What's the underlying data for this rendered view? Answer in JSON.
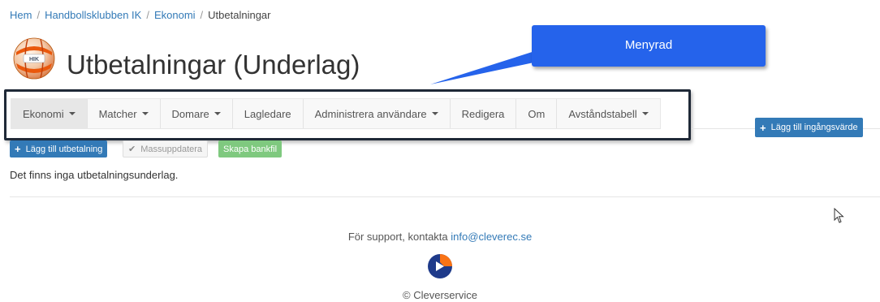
{
  "breadcrumb": {
    "items": [
      "Hem",
      "Handbollsklubben IK",
      "Ekonomi"
    ],
    "current": "Utbetalningar",
    "separator": "/"
  },
  "logo": {
    "text": "HIK"
  },
  "page": {
    "title": "Utbetalningar (Underlag)"
  },
  "callout": {
    "text": "Menyrad"
  },
  "menu": {
    "items": [
      {
        "label": "Ekonomi",
        "dropdown": true
      },
      {
        "label": "Matcher",
        "dropdown": true
      },
      {
        "label": "Domare",
        "dropdown": true
      },
      {
        "label": "Lagledare",
        "dropdown": false
      },
      {
        "label": "Administrera användare",
        "dropdown": true
      },
      {
        "label": "Redigera",
        "dropdown": false
      },
      {
        "label": "Om",
        "dropdown": false
      },
      {
        "label": "Avståndstabell",
        "dropdown": true
      }
    ]
  },
  "actions": {
    "add_initial_value": "Lägg till ingångsvärde",
    "add_payment": "Lägg till utbetalning",
    "bulk_update": "Massuppdatera",
    "create_bank_file": "Skapa bankfil"
  },
  "main": {
    "empty_message": "Det finns inga utbetalningsunderlag."
  },
  "footer": {
    "support_prefix": "För support, kontakta",
    "support_email": "info@cleverec.se",
    "copyright": "© Cleverservice"
  },
  "colors": {
    "primary": "#337ab7",
    "callout": "#2563eb",
    "success": "#7fc97f",
    "ball_orange": "#ea580c",
    "footer_logo_orange": "#f97316",
    "footer_logo_navy": "#1e3a8a"
  }
}
